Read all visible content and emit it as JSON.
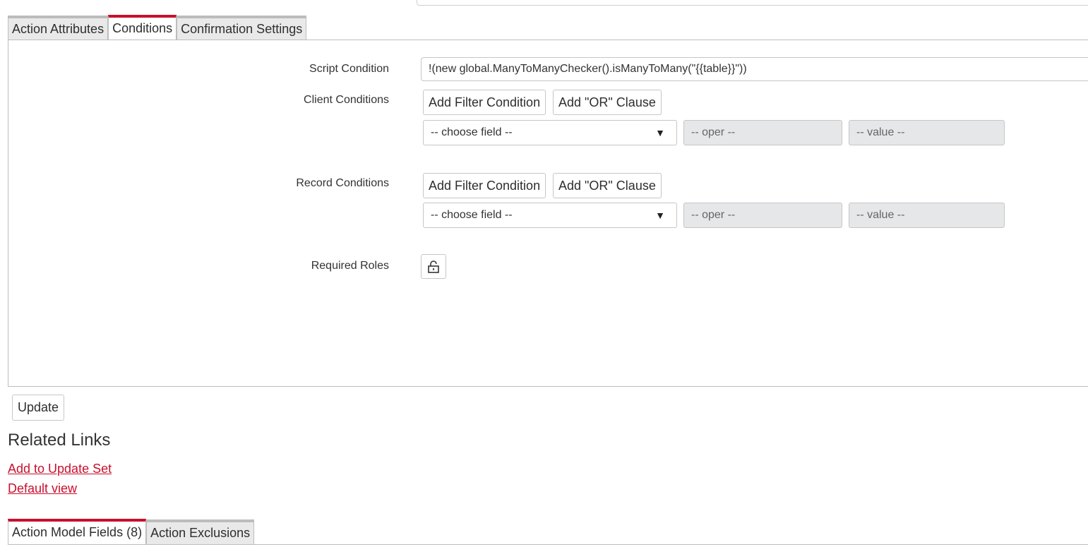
{
  "form_tabs": [
    "Action Attributes",
    "Conditions",
    "Confirmation Settings"
  ],
  "active_form_tab": "Conditions",
  "fields": {
    "script_condition": {
      "label": "Script Condition",
      "value": "!(new global.ManyToManyChecker().isManyToMany(\"{{table}}\"))"
    },
    "client_conditions": {
      "label": "Client Conditions",
      "add_filter_label": "Add Filter Condition",
      "add_or_label": "Add \"OR\" Clause",
      "field_select": "-- choose field --",
      "operator": "-- oper --",
      "value": "-- value --"
    },
    "record_conditions": {
      "label": "Record Conditions",
      "add_filter_label": "Add Filter Condition",
      "add_or_label": "Add \"OR\" Clause",
      "field_select": "-- choose field --",
      "operator": "-- oper --",
      "value": "-- value --"
    },
    "required_roles": {
      "label": "Required Roles",
      "icon": "lock-icon"
    }
  },
  "update_label": "Update",
  "related_links": {
    "title": "Related Links",
    "items": [
      "Add to Update Set",
      "Default view"
    ]
  },
  "related_tabs": [
    "Action Model Fields (8)",
    "Action Exclusions"
  ],
  "active_related_tab": "Action Model Fields (8)",
  "colors": {
    "accent": "#c8102e",
    "tab_inactive": "#e9e9ea",
    "disabled_field": "#e6e7e8"
  }
}
